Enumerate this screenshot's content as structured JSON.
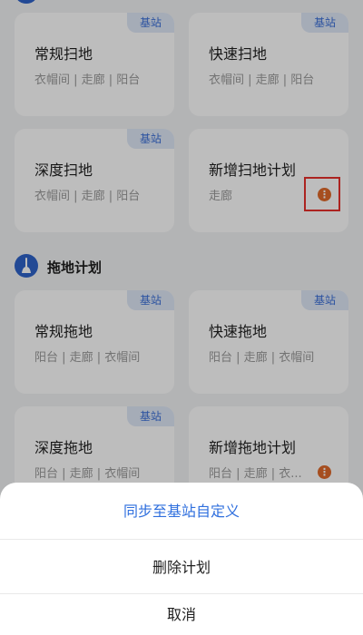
{
  "colors": {
    "page_bg": "#f2f3f5",
    "accent_blue": "#2f6fde",
    "tag_text": "#3a6fd8",
    "more_orange": "#e06a2b",
    "highlight_red": "#e8302c"
  },
  "sweep_cards": [
    {
      "tag": "基站",
      "title": "常规扫地",
      "rooms": "衣帽间 | 走廊 | 阳台"
    },
    {
      "tag": "基站",
      "title": "快速扫地",
      "rooms": "衣帽间 | 走廊 | 阳台"
    },
    {
      "tag": "基站",
      "title": "深度扫地",
      "rooms": "衣帽间 | 走廊 | 阳台"
    },
    {
      "title": "新增扫地计划",
      "rooms": "走廊",
      "more_icon": "more-dots-icon"
    }
  ],
  "mop_section": {
    "icon": "mop-icon",
    "title": "拖地计划"
  },
  "mop_cards": [
    {
      "tag": "基站",
      "title": "常规拖地",
      "rooms": "阳台 | 走廊 | 衣帽间"
    },
    {
      "tag": "基站",
      "title": "快速拖地",
      "rooms": "阳台 | 走廊 | 衣帽间"
    },
    {
      "tag": "基站",
      "title": "深度拖地",
      "rooms": "阳台 | 走廊 | 衣帽间"
    },
    {
      "title": "新增拖地计划",
      "rooms": "阳台 | 走廊 | 衣...",
      "more_icon": "more-dots-icon"
    }
  ],
  "action_sheet": {
    "sync_label": "同步至基站自定义",
    "delete_label": "删除计划",
    "cancel_label": "取消"
  }
}
